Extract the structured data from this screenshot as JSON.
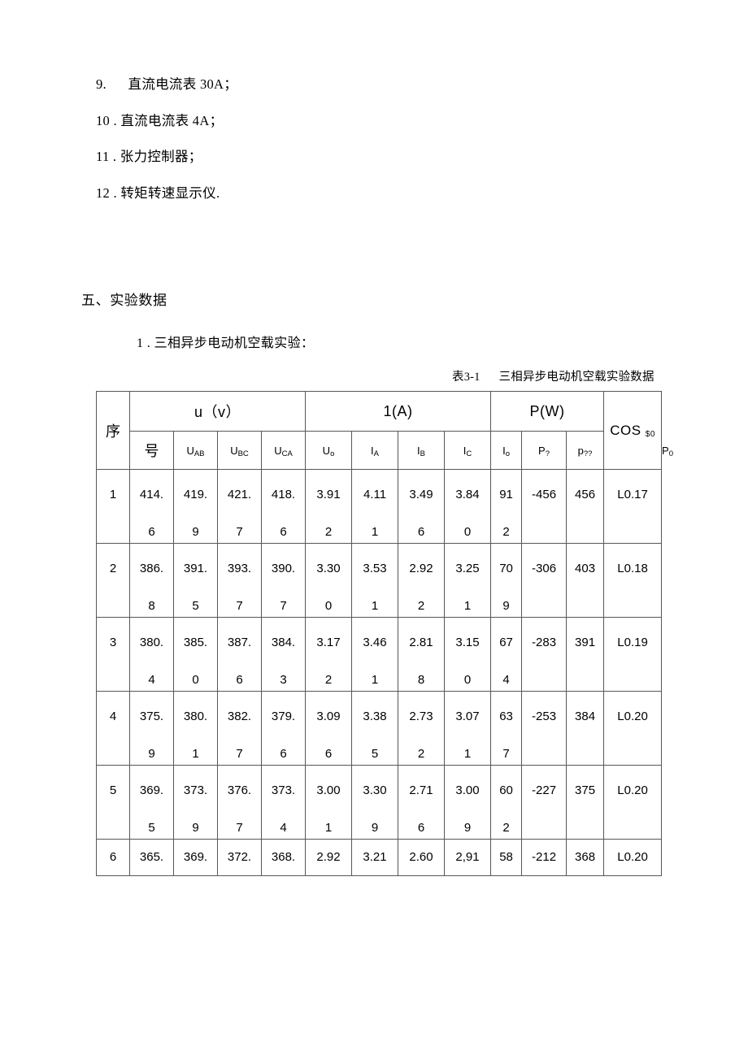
{
  "list": {
    "items": [
      {
        "num": "9.",
        "gap": "      ",
        "text": "直流电流表 30A；"
      },
      {
        "num": "10",
        "gap": " . ",
        "text": "直流电流表 4A；"
      },
      {
        "num": "11",
        "gap": " . ",
        "text": "张力控制器；"
      },
      {
        "num": "12",
        "gap": " . ",
        "text": "转矩转速显示仪."
      }
    ],
    "lines": [
      "9.      直流电流表 30A；",
      "10 . 直流电流表 4A；",
      "11 . 张力控制器；",
      "12 . 转矩转速显示仪."
    ]
  },
  "section": {
    "heading": "五、实验数据",
    "sub_item": "1 . 三相异步电动机空载实验："
  },
  "table": {
    "caption": "表3-1      三相异步电动机空载实验数据",
    "seq_header_line1": "序",
    "seq_header_line2": "号",
    "groups": [
      {
        "label": "u（v）",
        "span": 4
      },
      {
        "label": "1(A)",
        "span": 4
      },
      {
        "label": "P(W)",
        "span": 3
      }
    ],
    "cos_header": {
      "main": "COS",
      "sub": "$0"
    },
    "sub_headers": [
      {
        "main": "U",
        "sub": "AB"
      },
      {
        "main": "U",
        "sub": "BC"
      },
      {
        "main": "U",
        "sub": "CA"
      },
      {
        "main": "U",
        "sub": "o"
      },
      {
        "main": "I",
        "sub": "A"
      },
      {
        "main": "I",
        "sub": "B"
      },
      {
        "main": "I",
        "sub": "C"
      },
      {
        "main": "I",
        "sub": "o"
      },
      {
        "main": "P",
        "sub": "?"
      },
      {
        "main": "p",
        "sub": "??"
      },
      {
        "main": "P",
        "sub": "0"
      }
    ],
    "rows": [
      {
        "seq": "1",
        "cells": [
          {
            "l1": "414.",
            "l2": "6"
          },
          {
            "l1": "419.",
            "l2": "9"
          },
          {
            "l1": "421.",
            "l2": "7"
          },
          {
            "l1": "418.",
            "l2": "6"
          },
          {
            "l1": "3.91",
            "l2": "2"
          },
          {
            "l1": "4.11",
            "l2": "1"
          },
          {
            "l1": "3.49",
            "l2": "6"
          },
          {
            "l1": "3.84",
            "l2": "0"
          },
          {
            "l1": "91",
            "l2": "2"
          },
          {
            "l1": "-456",
            "l2": ""
          },
          {
            "l1": "456",
            "l2": ""
          },
          {
            "l1": "L0.17",
            "l2": ""
          }
        ]
      },
      {
        "seq": "2",
        "cells": [
          {
            "l1": "386.",
            "l2": "8"
          },
          {
            "l1": "391.",
            "l2": "5"
          },
          {
            "l1": "393.",
            "l2": "7"
          },
          {
            "l1": "390.",
            "l2": "7"
          },
          {
            "l1": "3.30",
            "l2": "0"
          },
          {
            "l1": "3.53",
            "l2": "1"
          },
          {
            "l1": "2.92",
            "l2": "2"
          },
          {
            "l1": "3.25",
            "l2": "1"
          },
          {
            "l1": "70",
            "l2": "9"
          },
          {
            "l1": "-306",
            "l2": ""
          },
          {
            "l1": "403",
            "l2": ""
          },
          {
            "l1": "L0.18",
            "l2": ""
          }
        ]
      },
      {
        "seq": "3",
        "cells": [
          {
            "l1": "380.",
            "l2": "4"
          },
          {
            "l1": "385.",
            "l2": "0"
          },
          {
            "l1": "387.",
            "l2": "6"
          },
          {
            "l1": "384.",
            "l2": "3"
          },
          {
            "l1": "3.17",
            "l2": "2"
          },
          {
            "l1": "3.46",
            "l2": "1"
          },
          {
            "l1": "2.81",
            "l2": "8"
          },
          {
            "l1": "3.15",
            "l2": "0"
          },
          {
            "l1": "67",
            "l2": "4"
          },
          {
            "l1": "-283",
            "l2": ""
          },
          {
            "l1": "391",
            "l2": ""
          },
          {
            "l1": "L0.19",
            "l2": ""
          }
        ]
      },
      {
        "seq": "4",
        "cells": [
          {
            "l1": "375.",
            "l2": "9"
          },
          {
            "l1": "380.",
            "l2": "1"
          },
          {
            "l1": "382.",
            "l2": "7"
          },
          {
            "l1": "379.",
            "l2": "6"
          },
          {
            "l1": "3.09",
            "l2": "6"
          },
          {
            "l1": "3.38",
            "l2": "5"
          },
          {
            "l1": "2.73",
            "l2": "2"
          },
          {
            "l1": "3.07",
            "l2": "1"
          },
          {
            "l1": "63",
            "l2": "7"
          },
          {
            "l1": "-253",
            "l2": ""
          },
          {
            "l1": "384",
            "l2": ""
          },
          {
            "l1": "L0.20",
            "l2": ""
          }
        ]
      },
      {
        "seq": "5",
        "cells": [
          {
            "l1": "369.",
            "l2": "5"
          },
          {
            "l1": "373.",
            "l2": "9"
          },
          {
            "l1": "376.",
            "l2": "7"
          },
          {
            "l1": "373.",
            "l2": "4"
          },
          {
            "l1": "3.00",
            "l2": "1"
          },
          {
            "l1": "3.30",
            "l2": "9"
          },
          {
            "l1": "2.71",
            "l2": "6"
          },
          {
            "l1": "3.00",
            "l2": "9"
          },
          {
            "l1": "60",
            "l2": "2"
          },
          {
            "l1": "-227",
            "l2": ""
          },
          {
            "l1": "375",
            "l2": ""
          },
          {
            "l1": "L0.20",
            "l2": ""
          }
        ]
      },
      {
        "seq": "6",
        "clipped": true,
        "cells": [
          {
            "l1": "365.",
            "l2": ""
          },
          {
            "l1": "369.",
            "l2": ""
          },
          {
            "l1": "372.",
            "l2": ""
          },
          {
            "l1": "368.",
            "l2": ""
          },
          {
            "l1": "2.92",
            "l2": ""
          },
          {
            "l1": "3.21",
            "l2": ""
          },
          {
            "l1": "2.60",
            "l2": ""
          },
          {
            "l1": "2,91",
            "l2": ""
          },
          {
            "l1": "58",
            "l2": ""
          },
          {
            "l1": "-212",
            "l2": ""
          },
          {
            "l1": "368",
            "l2": ""
          },
          {
            "l1": "L0.20",
            "l2": ""
          }
        ]
      }
    ]
  }
}
